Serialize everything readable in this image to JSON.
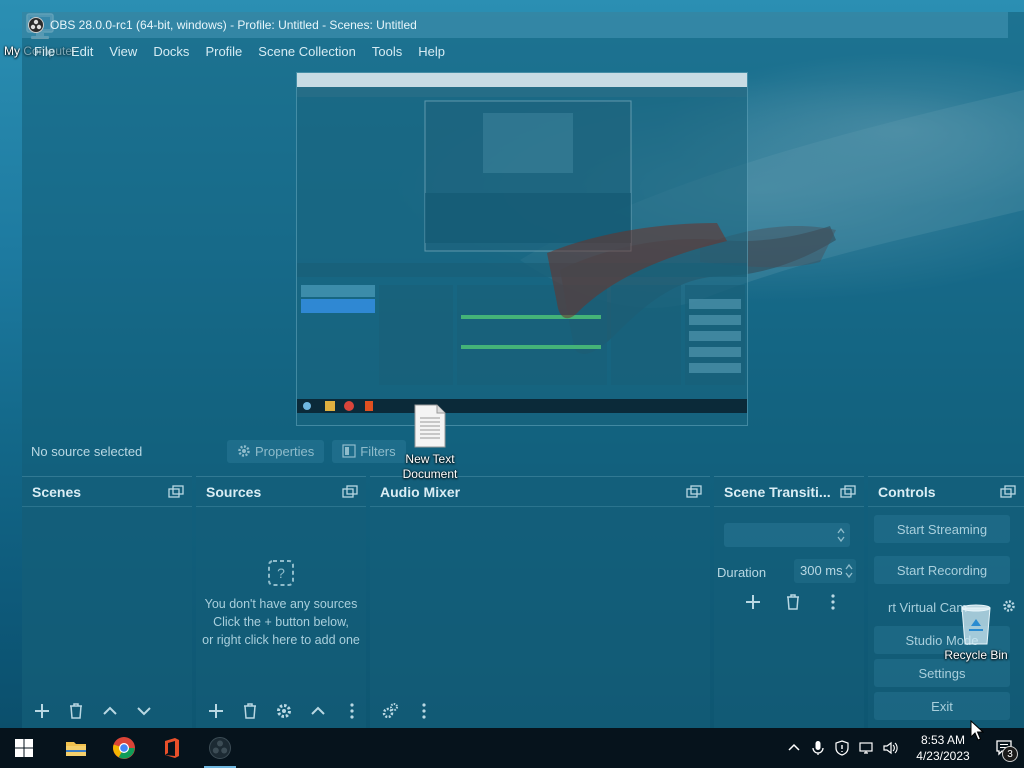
{
  "window": {
    "title": "OBS 28.0.0-rc1 (64-bit, windows) - Profile: Untitled - Scenes: Untitled"
  },
  "menu": [
    "File",
    "Edit",
    "View",
    "Docks",
    "Profile",
    "Scene Collection",
    "Tools",
    "Help"
  ],
  "source_toolbar": {
    "no_source": "No source selected",
    "properties": "Properties",
    "filters": "Filters"
  },
  "docks": {
    "scenes": {
      "title": "Scenes"
    },
    "sources": {
      "title": "Sources",
      "empty_line1": "You don't have any sources",
      "empty_line2": "Click the + button below,",
      "empty_line3": "or right click here to add one"
    },
    "mixer": {
      "title": "Audio Mixer"
    },
    "transitions": {
      "title": "Scene Transiti...",
      "duration_label": "Duration",
      "duration_value": "300 ms"
    },
    "controls": {
      "title": "Controls",
      "start_streaming": "Start Streaming",
      "start_recording": "Start Recording",
      "virtual_cam": "rt Virtual Cam",
      "studio_mode": "Studio Mode",
      "settings": "Settings",
      "exit": "Exit"
    }
  },
  "desktop": {
    "my_computer": "My Computer",
    "text_doc": "New Text Document",
    "recycle_bin": "Recycle Bin"
  },
  "taskbar": {
    "time": "8:53 AM",
    "date": "4/23/2023",
    "notification_count": "3"
  },
  "colors": {
    "wallpaper_top": "#2b8fb3",
    "wallpaper_bottom": "#0b4f6c",
    "taskbar": "#06131c"
  }
}
